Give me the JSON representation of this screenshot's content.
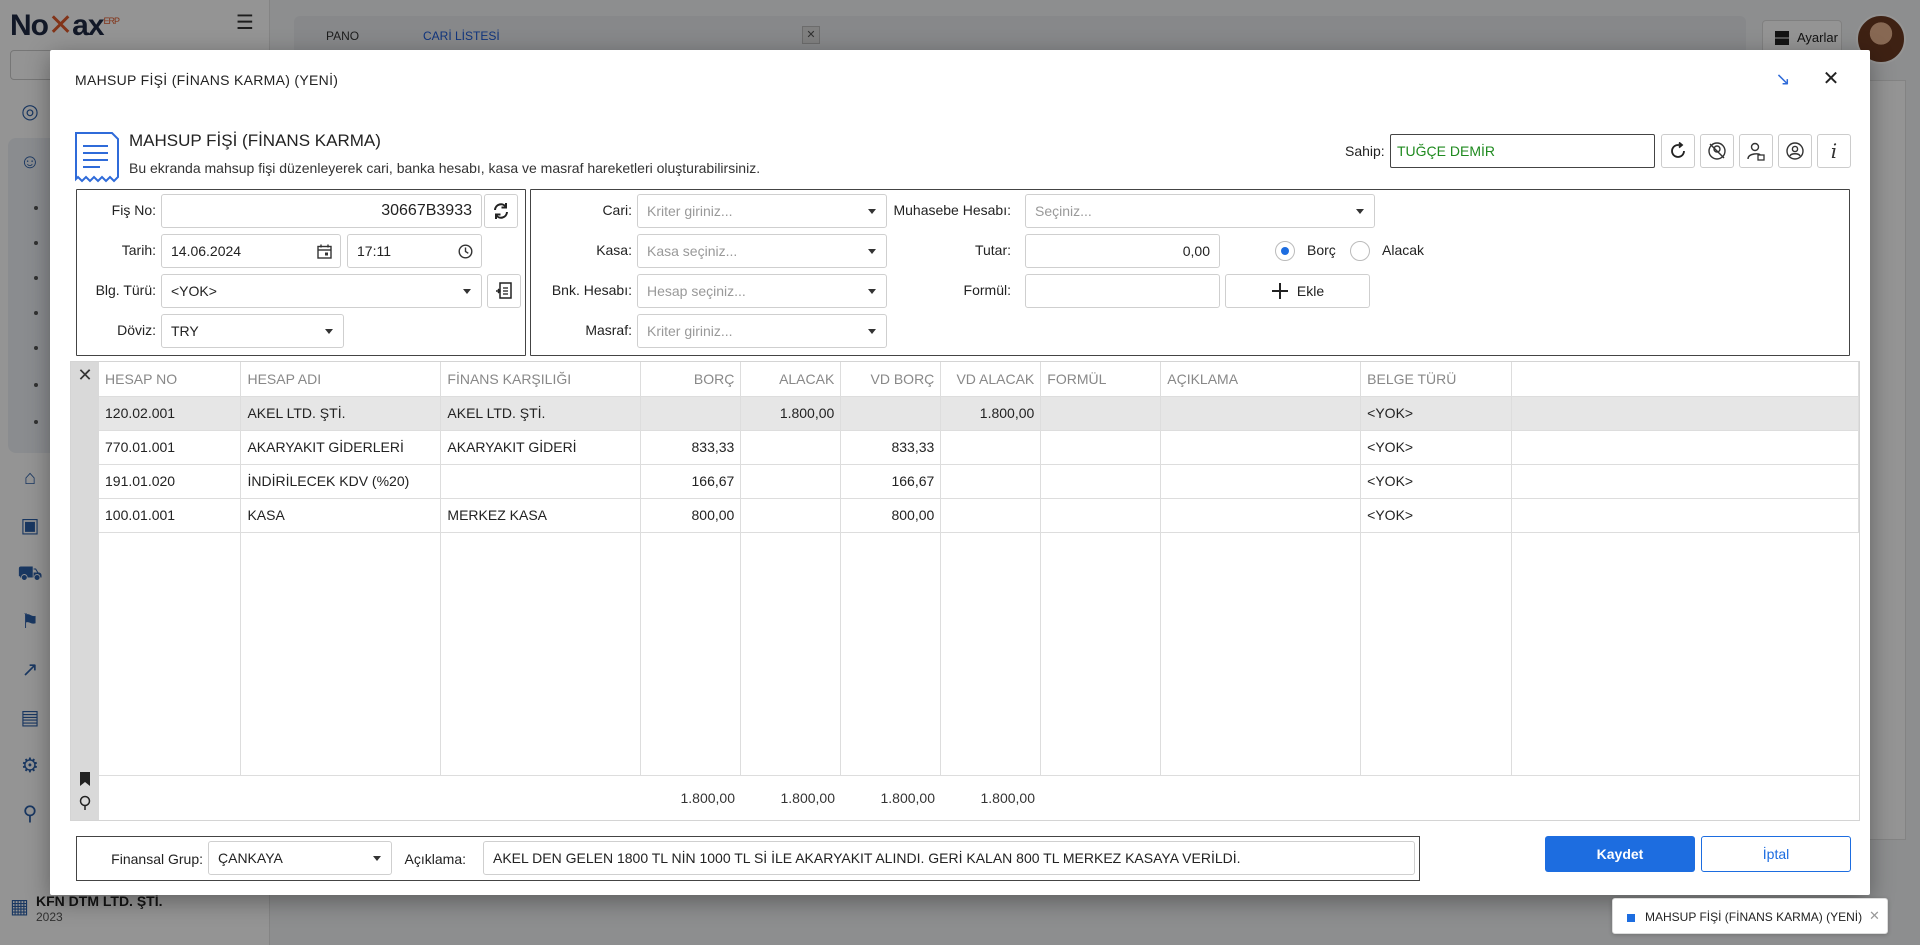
{
  "app": {
    "logo": "No",
    "logo_rest": "ax",
    "logo_sup": "ERP",
    "company_name": "KFN DTM LTD. ŞTİ.",
    "company_year": "2023",
    "tabs": [
      {
        "label": "PANO"
      },
      {
        "label": "CARİ LİSTESİ"
      }
    ],
    "settings_label": "Ayarlar"
  },
  "modal": {
    "title": "MAHSUP FİŞİ (FİNANS KARMA) (YENİ)",
    "heading": "MAHSUP FİŞİ (FİNANS KARMA)",
    "description": "Bu ekranda mahsup fişi düzenleyerek cari, banka hesabı, kasa ve masraf hareketleri oluşturabilirsiniz.",
    "owner_label": "Sahip:",
    "owner_value": "TUĞÇE DEMİR"
  },
  "form_left": {
    "fis_no_label": "Fiş No:",
    "fis_no_value": "30667B3933",
    "tarih_label": "Tarih:",
    "tarih_value": "14.06.2024",
    "saat_value": "17:11",
    "blg_turu_label": "Blg. Türü:",
    "blg_turu_value": "<YOK>",
    "doviz_label": "Döviz:",
    "doviz_value": "TRY"
  },
  "form_right": {
    "cari_label": "Cari:",
    "cari_placeholder": "Kriter giriniz...",
    "kasa_label": "Kasa:",
    "kasa_placeholder": "Kasa seçiniz...",
    "bnk_label": "Bnk. Hesabı:",
    "bnk_placeholder": "Hesap seçiniz...",
    "masraf_label": "Masraf:",
    "masraf_placeholder": "Kriter giriniz...",
    "muhasebe_label": "Muhasebe Hesabı:",
    "muhasebe_placeholder": "Seçiniz...",
    "tutar_label": "Tutar:",
    "tutar_value": "0,00",
    "borc_label": "Borç",
    "alacak_label": "Alacak",
    "formul_label": "Formül:",
    "ekle_label": "Ekle"
  },
  "grid": {
    "columns": [
      "HESAP NO",
      "HESAP ADI",
      "FİNANS KARŞILIĞI",
      "BORÇ",
      "ALACAK",
      "VD BORÇ",
      "VD ALACAK",
      "FORMÜL",
      "AÇIKLAMA",
      "BELGE TÜRÜ",
      ""
    ],
    "rows": [
      [
        "120.02.001",
        "AKEL LTD. ŞTİ.",
        "AKEL LTD. ŞTİ.",
        "",
        "1.800,00",
        "",
        "1.800,00",
        "",
        "",
        "<YOK>",
        ""
      ],
      [
        "770.01.001",
        "AKARYAKIT GİDERLERİ",
        "AKARYAKIT GİDERİ",
        "833,33",
        "",
        "833,33",
        "",
        "",
        "",
        "<YOK>",
        ""
      ],
      [
        "191.01.020",
        "İNDİRİLECEK KDV (%20)",
        "",
        "166,67",
        "",
        "166,67",
        "",
        "",
        "",
        "<YOK>",
        ""
      ],
      [
        "100.01.001",
        "KASA",
        "MERKEZ KASA",
        "800,00",
        "",
        "800,00",
        "",
        "",
        "",
        "<YOK>",
        ""
      ]
    ],
    "totals": {
      "borc": "1.800,00",
      "alacak": "1.800,00",
      "vd_borc": "1.800,00",
      "vd_alacak": "1.800,00"
    }
  },
  "bottom": {
    "finansal_grup_label": "Finansal Grup:",
    "finansal_grup_value": "ÇANKAYA",
    "aciklama_label": "Açıklama:",
    "aciklama_value": "AKEL DEN GELEN 1800 TL NİN 1000 TL Sİ İLE AKARYAKIT ALINDI. GERİ KALAN 800 TL MERKEZ KASAYA VERİLDİ.",
    "save_label": "Kaydet",
    "cancel_label": "İptal"
  },
  "taskbar": {
    "chip_label": "MAHSUP FİŞİ (FİNANS KARMA) (YENİ)"
  },
  "colors": {
    "accent": "#1d6de0",
    "owner_text": "#1f8a1f",
    "selected_row": "#e6e6e6"
  }
}
